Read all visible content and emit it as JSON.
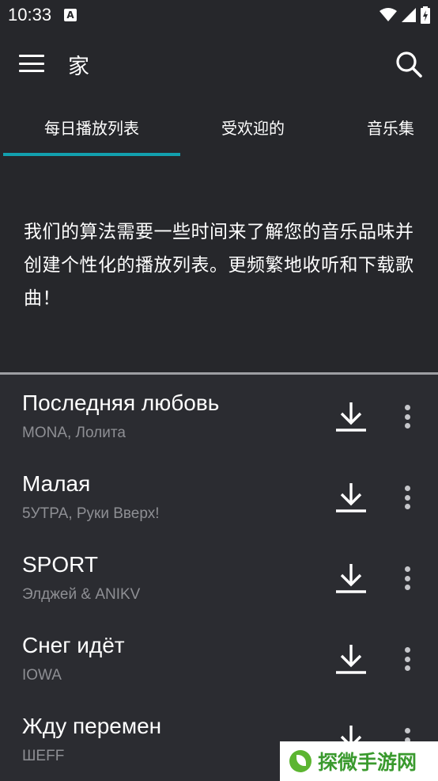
{
  "status_bar": {
    "time": "10:33",
    "notification_glyph": "A"
  },
  "app_bar": {
    "title": "家"
  },
  "tabs": [
    {
      "label": "每日播放列表",
      "selected": true
    },
    {
      "label": "受欢迎的",
      "selected": false
    },
    {
      "label": "音乐集",
      "selected": false
    }
  ],
  "message": "我们的算法需要一些时间来了解您的音乐品味并创建个性化的播放列表。更频繁地收听和下载歌曲！",
  "songs": [
    {
      "title": "Последняя любовь",
      "artist": "MONA, Лолита"
    },
    {
      "title": "Малая",
      "artist": "5УТРА, Руки Вверх!"
    },
    {
      "title": "SPORT",
      "artist": "Элджей  & ANIKV"
    },
    {
      "title": "Снег идёт",
      "artist": "IOWA"
    },
    {
      "title": "Жду перемен",
      "artist": "ШЕFF"
    }
  ],
  "watermark": {
    "text": "探微手游网"
  },
  "colors": {
    "background": "#26272b",
    "list_background": "#2b2c31",
    "accent": "#12a0ae",
    "secondary_text": "#8e8f94"
  }
}
